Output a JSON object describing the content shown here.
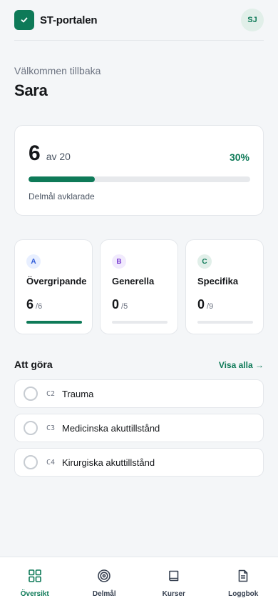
{
  "header": {
    "brand": "ST-portalen",
    "avatar_initials": "SJ"
  },
  "greeting": {
    "welcome": "Välkommen tillbaka",
    "name": "Sara"
  },
  "progress": {
    "completed": "6",
    "of_label": "av 20",
    "percent_label": "30%",
    "fraction": 0.3,
    "caption": "Delmål avklarade"
  },
  "categories": [
    {
      "letter": "A",
      "name": "Övergripande",
      "done": "6",
      "total": "/6",
      "fraction": 1.0,
      "badge_bg": "#e8efff",
      "badge_fg": "#2f5bd8"
    },
    {
      "letter": "B",
      "name": "Generella",
      "done": "0",
      "total": "/5",
      "fraction": 0.0,
      "badge_bg": "#f1eafd",
      "badge_fg": "#7a3fd1"
    },
    {
      "letter": "C",
      "name": "Specifika",
      "done": "0",
      "total": "/9",
      "fraction": 0.0,
      "badge_bg": "#e1efe9",
      "badge_fg": "#0e7a58"
    }
  ],
  "todo": {
    "title": "Att göra",
    "link": "Visa alla →",
    "items": [
      {
        "code": "C2",
        "label": "Trauma"
      },
      {
        "code": "C3",
        "label": "Medicinska akuttillstånd"
      },
      {
        "code": "C4",
        "label": "Kirurgiska akuttillstånd"
      }
    ]
  },
  "tabs": [
    {
      "label": "Översikt",
      "icon": "grid-icon",
      "active": true
    },
    {
      "label": "Delmål",
      "icon": "target-icon",
      "active": false
    },
    {
      "label": "Kurser",
      "icon": "book-icon",
      "active": false
    },
    {
      "label": "Loggbok",
      "icon": "document-icon",
      "active": false
    }
  ],
  "colors": {
    "accent": "#0e7a58",
    "background": "#f4f6f8"
  }
}
